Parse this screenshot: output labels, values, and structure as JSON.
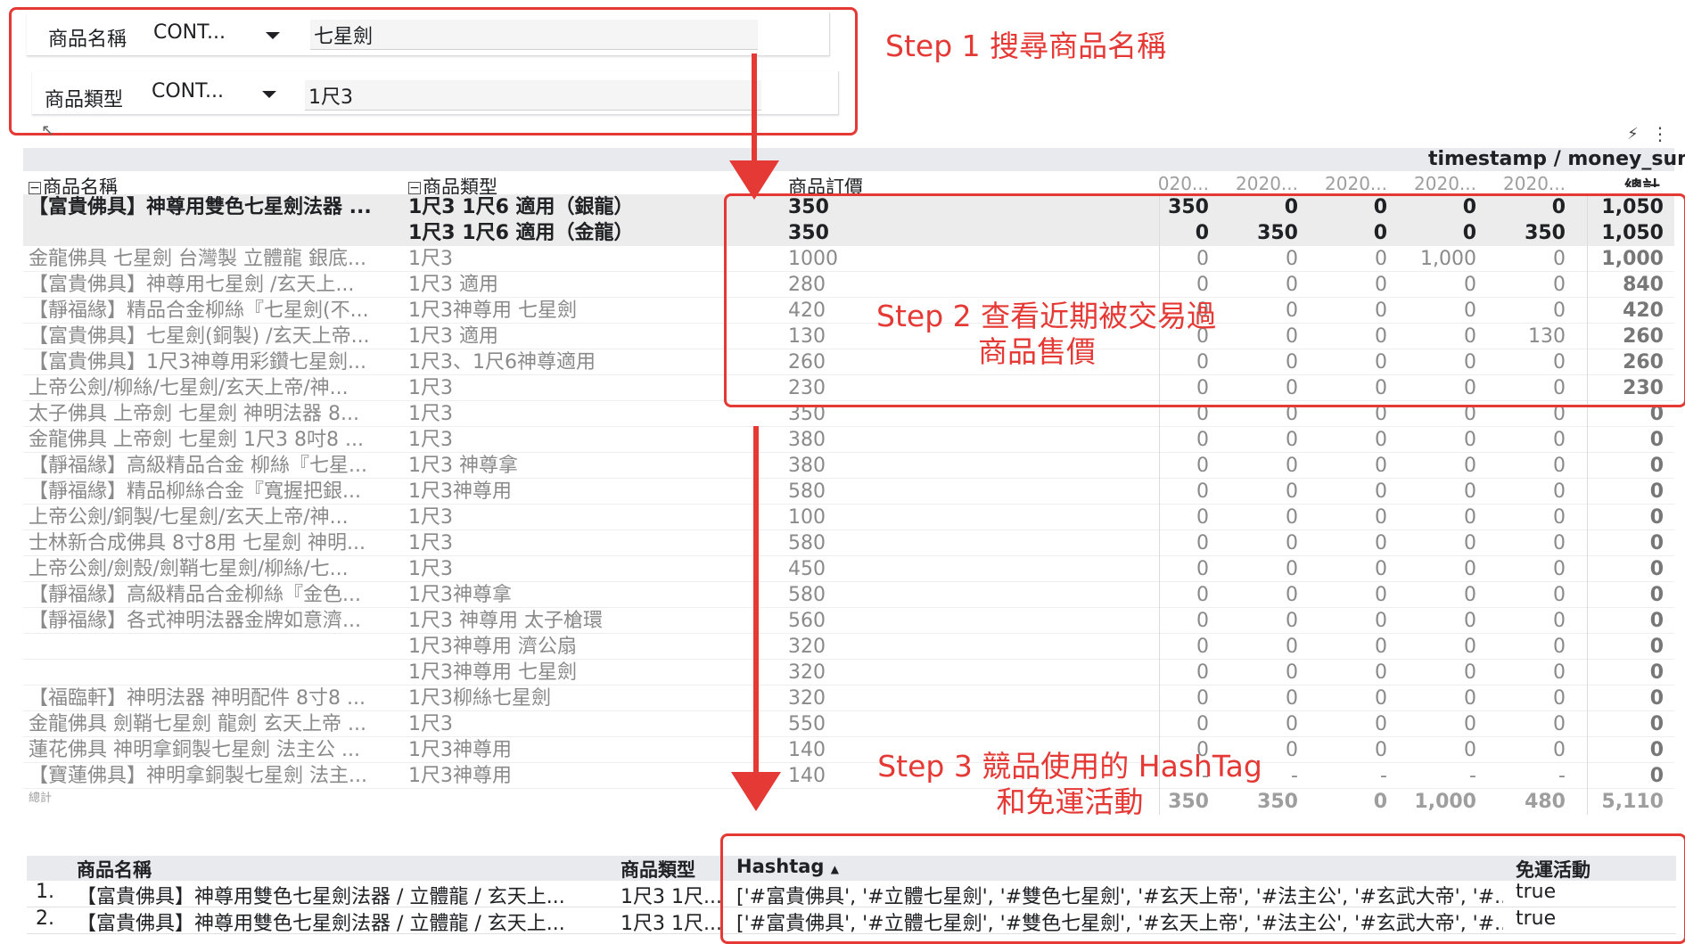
{
  "filters": [
    {
      "label": "商品名稱",
      "operator": "CONT...",
      "value": "七星劍"
    },
    {
      "label": "商品類型",
      "operator": "CONT...",
      "value": "1尺3"
    }
  ],
  "annotations": {
    "step1": "Step 1 搜尋商品名稱",
    "step2_line1": "Step 2 查看近期被交易過",
    "step2_line2": "商品售價",
    "step3_line1": "Step 3 競品使用的 HashTag",
    "step3_line2": "和免運活動"
  },
  "pivot": {
    "metric_header": "timestamp / money_sum",
    "col_name": "商品名稱",
    "col_type": "商品類型",
    "col_price": "商品訂價",
    "date_cols": [
      "020...",
      "2020...",
      "2020...",
      "2020...",
      "2020..."
    ],
    "total_col": "總計",
    "rows": [
      {
        "name": "【富貴佛具】神尊用雙色七星劍法器 ...",
        "type": "1尺3 1尺6 適用（銀龍）",
        "price": "350",
        "v": [
          "350",
          "0",
          "0",
          "0",
          "0"
        ],
        "total": "1,050",
        "bold": true
      },
      {
        "name": "",
        "type": "1尺3 1尺6 適用（金龍）",
        "price": "350",
        "v": [
          "0",
          "350",
          "0",
          "0",
          "350"
        ],
        "total": "1,050",
        "bold": true
      },
      {
        "name": "金龍佛具 七星劍 台灣製 立體龍 銀底...",
        "type": "1尺3",
        "price": "1000",
        "v": [
          "0",
          "0",
          "0",
          "1,000",
          "0"
        ],
        "total": "1,000"
      },
      {
        "name": "【富貴佛具】神尊用七星劍 /玄天上...",
        "type": "1尺3 適用",
        "price": "280",
        "v": [
          "0",
          "0",
          "0",
          "0",
          "0"
        ],
        "total": "840"
      },
      {
        "name": "【靜福緣】精品合金柳絲『七星劍(不...",
        "type": "1尺3神尊用 七星劍",
        "price": "420",
        "v": [
          "0",
          "0",
          "0",
          "0",
          "0"
        ],
        "total": "420"
      },
      {
        "name": "【富貴佛具】七星劍(銅製) /玄天上帝...",
        "type": "1尺3 適用",
        "price": "130",
        "v": [
          "0",
          "0",
          "0",
          "0",
          "130"
        ],
        "total": "260"
      },
      {
        "name": "【富貴佛具】1尺3神尊用彩鑽七星劍...",
        "type": "1尺3、1尺6神尊適用",
        "price": "260",
        "v": [
          "0",
          "0",
          "0",
          "0",
          "0"
        ],
        "total": "260"
      },
      {
        "name": "上帝公劍/柳絲/七星劍/玄天上帝/神...",
        "type": "1尺3",
        "price": "230",
        "v": [
          "0",
          "0",
          "0",
          "0",
          "0"
        ],
        "total": "230"
      },
      {
        "name": "太子佛具 上帝劍 七星劍 神明法器 8...",
        "type": "1尺3",
        "price": "350",
        "v": [
          "0",
          "0",
          "0",
          "0",
          "0"
        ],
        "total": "0"
      },
      {
        "name": "金龍佛具 上帝劍 七星劍 1尺3 8吋8 ...",
        "type": "1尺3",
        "price": "380",
        "v": [
          "0",
          "0",
          "0",
          "0",
          "0"
        ],
        "total": "0"
      },
      {
        "name": "【靜福緣】高級精品合金 柳絲『七星...",
        "type": "1尺3 神尊拿",
        "price": "380",
        "v": [
          "0",
          "0",
          "0",
          "0",
          "0"
        ],
        "total": "0"
      },
      {
        "name": "【靜福緣】精品柳絲合金『寬握把銀...",
        "type": "1尺3神尊用",
        "price": "580",
        "v": [
          "0",
          "0",
          "0",
          "0",
          "0"
        ],
        "total": "0"
      },
      {
        "name": "上帝公劍/銅製/七星劍/玄天上帝/神...",
        "type": "1尺3",
        "price": "100",
        "v": [
          "0",
          "0",
          "0",
          "0",
          "0"
        ],
        "total": "0"
      },
      {
        "name": "士林新合成佛具 8寸8用 七星劍 神明...",
        "type": "1尺3",
        "price": "580",
        "v": [
          "0",
          "0",
          "0",
          "0",
          "0"
        ],
        "total": "0"
      },
      {
        "name": "上帝公劍/劍殼/劍鞘七星劍/柳絲/七...",
        "type": "1尺3",
        "price": "450",
        "v": [
          "0",
          "0",
          "0",
          "0",
          "0"
        ],
        "total": "0"
      },
      {
        "name": "【靜福緣】高級精品合金柳絲『金色...",
        "type": "1尺3神尊拿",
        "price": "580",
        "v": [
          "0",
          "0",
          "0",
          "0",
          "0"
        ],
        "total": "0"
      },
      {
        "name": "【靜福緣】各式神明法器金牌如意濟...",
        "type": "1尺3 神尊用 太子槍環",
        "price": "560",
        "v": [
          "0",
          "0",
          "0",
          "0",
          "0"
        ],
        "total": "0"
      },
      {
        "name": "",
        "type": "1尺3神尊用 濟公扇",
        "price": "320",
        "v": [
          "0",
          "0",
          "0",
          "0",
          "0"
        ],
        "total": "0"
      },
      {
        "name": "",
        "type": "1尺3神尊用 七星劍",
        "price": "320",
        "v": [
          "0",
          "0",
          "0",
          "0",
          "0"
        ],
        "total": "0"
      },
      {
        "name": "【福臨軒】神明法器 神明配件 8寸8 ...",
        "type": "1尺3柳絲七星劍",
        "price": "320",
        "v": [
          "0",
          "0",
          "0",
          "0",
          "0"
        ],
        "total": "0"
      },
      {
        "name": "金龍佛具 劍鞘七星劍 龍劍 玄天上帝 ...",
        "type": "1尺3",
        "price": "550",
        "v": [
          "0",
          "0",
          "0",
          "0",
          "0"
        ],
        "total": "0"
      },
      {
        "name": "蓮花佛具 神明拿銅製七星劍 法主公 ...",
        "type": "1尺3神尊用",
        "price": "140",
        "v": [
          "0",
          "0",
          "0",
          "0",
          "0"
        ],
        "total": "0"
      },
      {
        "name": "【寶蓮佛具】神明拿銅製七星劍 法主...",
        "type": "1尺3神尊用",
        "price": "140",
        "v": [
          "-",
          "-",
          "-",
          "-",
          "-"
        ],
        "total": "0"
      }
    ],
    "grand_total": {
      "label": "總計",
      "v": [
        "350",
        "350",
        "0",
        "1,000",
        "480"
      ],
      "total": "5,110"
    }
  },
  "bottom_table": {
    "headers": {
      "name": "商品名稱",
      "type": "商品類型",
      "hashtag": "Hashtag",
      "shipping": "免運活動"
    },
    "rows": [
      {
        "idx": "1.",
        "name": "【富貴佛具】神尊用雙色七星劍法器 / 立體龍 / 玄天上...",
        "type": "1尺3 1尺...",
        "hashtag": "['#富貴佛具', '#立體七星劍', '#雙色七星劍', '#玄天上帝', '#法主公', '#玄武大帝', '#...",
        "shipping": "true"
      },
      {
        "idx": "2.",
        "name": "【富貴佛具】神尊用雙色七星劍法器 / 立體龍 / 玄天上...",
        "type": "1尺3 1尺...",
        "hashtag": "['#富貴佛具', '#立體七星劍', '#雙色七星劍', '#玄天上帝', '#法主公', '#玄武大帝', '#...",
        "shipping": "true"
      }
    ]
  },
  "colors": {
    "accent_red": "#e53935",
    "header_gray": "#e8eaed"
  }
}
